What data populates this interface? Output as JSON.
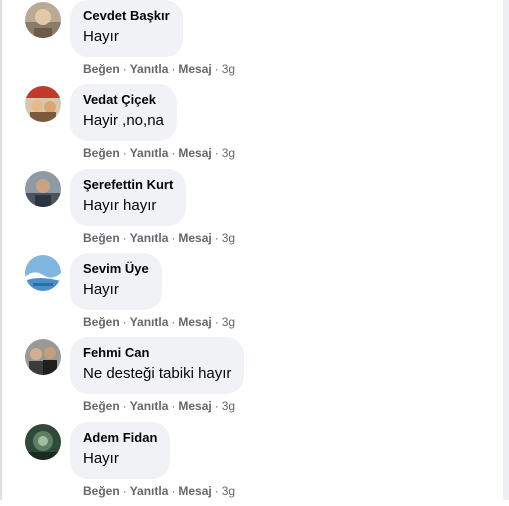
{
  "colors": {
    "bubble": "#f0f2f5",
    "text": "#050505",
    "meta": "#65676b"
  },
  "action_labels": {
    "like": "Beğen",
    "reply": "Yanıtla",
    "message": "Mesaj",
    "separator": "·"
  },
  "comments": [
    {
      "author": "Cevdet Başkır",
      "text": "Hayır",
      "time": "3g",
      "avatar_icon": "profile-photo"
    },
    {
      "author": "Vedat Çiçek",
      "text": "Hayir ,no,na",
      "time": "3g",
      "avatar_icon": "profile-photo"
    },
    {
      "author": "Şerefettin Kurt",
      "text": "Hayır hayır",
      "time": "3g",
      "avatar_icon": "profile-photo"
    },
    {
      "author": "Sevim Üye",
      "text": "Hayır",
      "time": "3g",
      "avatar_icon": "profile-photo"
    },
    {
      "author": "Fehmi Can",
      "text": "Ne desteği tabiki hayır",
      "time": "3g",
      "avatar_icon": "profile-photo"
    },
    {
      "author": "Adem Fidan",
      "text": "Hayır",
      "time": "3g",
      "avatar_icon": "profile-photo"
    }
  ]
}
